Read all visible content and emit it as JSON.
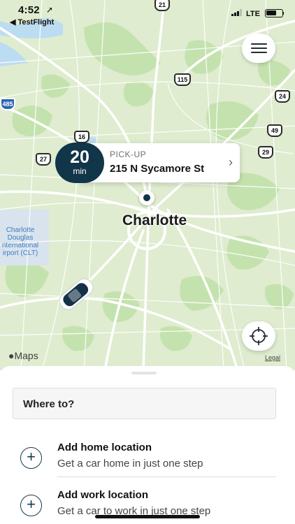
{
  "status_bar": {
    "time": "4:52",
    "back_app": "◀ TestFlight",
    "network": "LTE",
    "battery_level": 0.72
  },
  "map": {
    "city": "Charlotte",
    "airport_label": [
      "Charlotte",
      "Douglas",
      "nternational",
      "irport (CLT)"
    ],
    "route_shields": [
      "21",
      "115",
      "24",
      "485",
      "49",
      "16",
      "27",
      "29"
    ],
    "attribution": "Maps",
    "legal": "Legal",
    "colors": {
      "land": "#dfeccf",
      "park": "#c4e2ae",
      "road": "#ffffff",
      "water": "#bcdcf2"
    }
  },
  "pickup": {
    "eta_value": "20",
    "eta_unit": "min",
    "label": "PICK-UP",
    "address": "215 N Sycamore St",
    "chevron": "›",
    "accent": "#113549"
  },
  "sheet": {
    "search_label": "Where to?",
    "saved": [
      {
        "title": "Add home location",
        "subtitle": "Get a car home in just one step",
        "icon": "plus-circle-icon"
      },
      {
        "title": "Add work location",
        "subtitle": "Get a car to work in just one step",
        "icon": "plus-circle-icon"
      }
    ]
  }
}
